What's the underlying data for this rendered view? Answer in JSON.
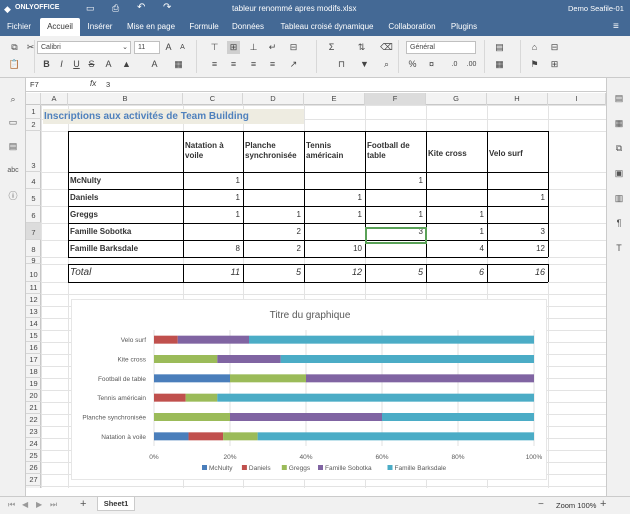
{
  "app": {
    "logo": "ONLYOFFICE",
    "filename": "tableur renommé apres modifs.xlsx",
    "user": "Demo Seafile-01"
  },
  "tabs": [
    "Fichier",
    "Accueil",
    "Insérer",
    "Mise en page",
    "Formule",
    "Données",
    "Tableau croisé dynamique",
    "Collaboration",
    "Plugins"
  ],
  "toolbar": {
    "font": "Calibri",
    "size": "11",
    "number_format": "Général"
  },
  "formula": {
    "cell_ref": "F7",
    "fx": "fx",
    "value": "3"
  },
  "columns": [
    "A",
    "B",
    "C",
    "D",
    "E",
    "F",
    "G",
    "H",
    "I"
  ],
  "rows": [
    "1",
    "2",
    "3",
    "4",
    "5",
    "6",
    "7",
    "8",
    "9",
    "10",
    "11",
    "12",
    "13",
    "14",
    "15",
    "16",
    "17",
    "18",
    "19",
    "20",
    "21",
    "22",
    "23",
    "24",
    "25",
    "26",
    "27"
  ],
  "sheet": {
    "title": "Inscriptions aux activités de Team Building",
    "headers": [
      "Natation à voile",
      "Planche synchronisée",
      "Tennis américain",
      "Football de table",
      "Kite cross",
      "Velo surf"
    ],
    "people": [
      {
        "name": "McNulty",
        "values": [
          "1",
          "",
          "",
          "1",
          "",
          ""
        ]
      },
      {
        "name": "Daniels",
        "values": [
          "1",
          "",
          "1",
          "",
          "",
          "1"
        ]
      },
      {
        "name": "Greggs",
        "values": [
          "1",
          "1",
          "1",
          "1",
          "1",
          ""
        ]
      },
      {
        "name": "Famille Sobotka",
        "values": [
          "",
          "2",
          "",
          "3",
          "1",
          "3"
        ]
      },
      {
        "name": "Famille Barksdale",
        "values": [
          "8",
          "2",
          "10",
          "",
          "4",
          "12"
        ]
      }
    ],
    "total_label": "Total",
    "totals": [
      "11",
      "5",
      "12",
      "5",
      "6",
      "16"
    ]
  },
  "chart_data": {
    "type": "bar",
    "orientation": "horizontal",
    "stacked": "percent",
    "title": "Titre du graphique",
    "categories": [
      "Natation à voile",
      "Planche synchronisée",
      "Tennis américain",
      "Football de table",
      "Kite cross",
      "Velo surf"
    ],
    "series": [
      {
        "name": "McNulty",
        "color": "#4a7ebb",
        "values": [
          1,
          0,
          0,
          1,
          0,
          0
        ]
      },
      {
        "name": "Daniels",
        "color": "#c0504d",
        "values": [
          1,
          0,
          1,
          0,
          0,
          1
        ]
      },
      {
        "name": "Greggs",
        "color": "#9bbb59",
        "values": [
          1,
          1,
          1,
          1,
          1,
          0
        ]
      },
      {
        "name": "Famille Sobotka",
        "color": "#8064a2",
        "values": [
          0,
          2,
          0,
          3,
          1,
          3
        ]
      },
      {
        "name": "Famille Barksdale",
        "color": "#4bacc6",
        "values": [
          8,
          2,
          10,
          0,
          4,
          12
        ]
      }
    ],
    "x_ticks": [
      "0%",
      "20%",
      "40%",
      "60%",
      "80%",
      "100%"
    ],
    "xlim": [
      0,
      100
    ],
    "legend": "bottom",
    "grid": true
  },
  "sheetbar": {
    "sheet": "Sheet1",
    "zoom": "Zoom 100%"
  }
}
